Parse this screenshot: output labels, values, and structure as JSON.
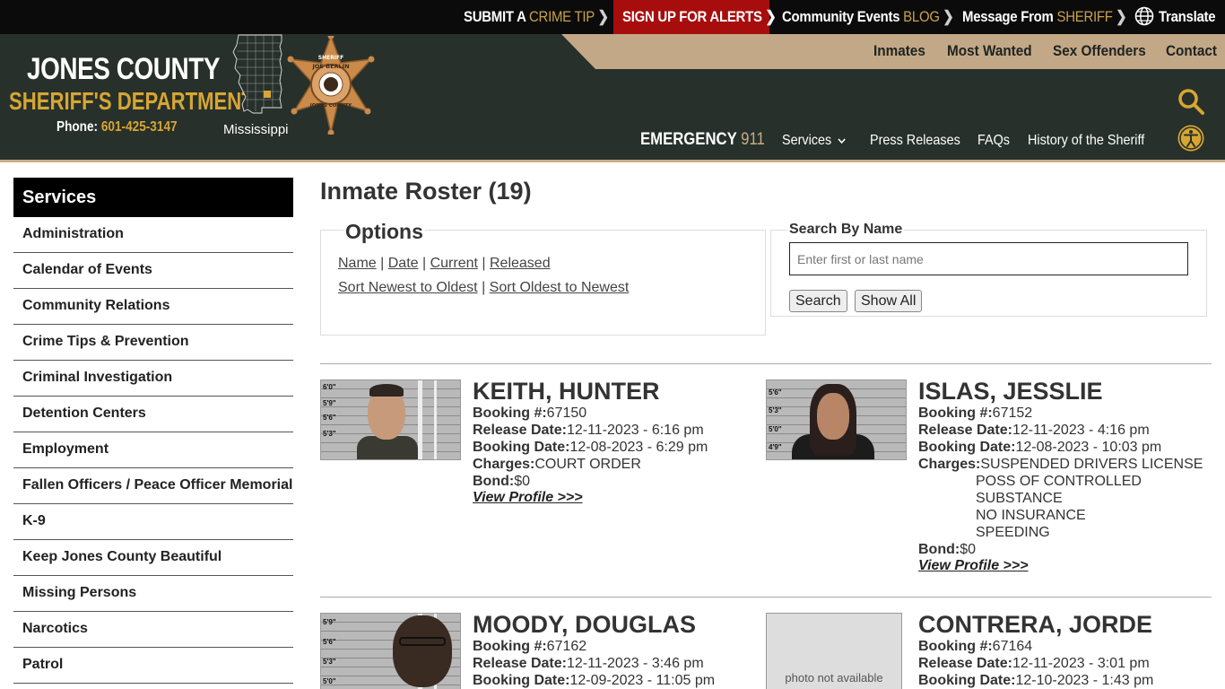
{
  "topbar": {
    "crime_tip": {
      "a": "SUBMIT A ",
      "b": "CRIME TIP",
      "chev": "❯"
    },
    "alerts": {
      "a": "SIGN UP FOR ALERTS",
      "chev": "❯"
    },
    "events": {
      "a": "Community Events ",
      "b": "BLOG",
      "chev": "❯"
    },
    "message": {
      "a": "Message From ",
      "b": "SHERIFF",
      "chev": "❯"
    },
    "translate": "Translate"
  },
  "logo": {
    "title": "JONES COUNTY",
    "subtitle": "SHERIFF'S DEPARTMENT",
    "phone_label": "Phone: ",
    "phone_number": "601-425-3147",
    "state_label": "Mississippi",
    "badge_top": "SHERIFF",
    "badge_name": "JOE BERLIN",
    "badge_bottom": "JONES COUNTY"
  },
  "nav_primary": [
    "Inmates",
    "Most Wanted",
    "Sex Offenders",
    "Contact"
  ],
  "emergency": {
    "label": "EMERGENCY ",
    "number": "911"
  },
  "nav_secondary": {
    "services": "Services",
    "press": "Press Releases",
    "faqs": "FAQs",
    "history": "History of the Sheriff"
  },
  "sidebar": {
    "heading": "Services",
    "items": [
      "Administration",
      "Calendar of Events",
      "Community Relations",
      "Crime Tips & Prevention",
      "Criminal Investigation",
      "Detention Centers",
      "Employment",
      "Fallen Officers / Peace Officer Memorial",
      "K-9",
      "Keep Jones County Beautiful",
      "Missing Persons",
      "Narcotics",
      "Patrol"
    ]
  },
  "main": {
    "title": "Inmate Roster (19)",
    "options": {
      "legend": "Options",
      "sort_name": "Name",
      "sort_date": "Date",
      "sort_current": "Current",
      "sort_released": "Released",
      "sep": " | ",
      "newest": "Sort Newest to Oldest",
      "oldest": "Sort Oldest to Newest"
    },
    "search": {
      "legend": "Search By Name",
      "placeholder": "Enter first or last name",
      "search_btn": "Search",
      "showall_btn": "Show All"
    }
  },
  "labels": {
    "booking": "Booking #:",
    "release": "Release Date:",
    "booking_date": "Booking Date:",
    "charges": "Charges:",
    "bond": "Bond:",
    "view": "View Profile >>>",
    "no_photo": "photo not available"
  },
  "inmates": [
    {
      "name": "KEITH, HUNTER",
      "booking": "67150",
      "release": "12-11-2023 - 6:16 pm",
      "booking_date": "12-08-2023 - 6:29 pm",
      "charges": [
        "COURT ORDER"
      ],
      "bond": "$0"
    },
    {
      "name": "ISLAS, JESSLIE",
      "booking": "67152",
      "release": "12-11-2023 - 4:16 pm",
      "booking_date": "12-08-2023 - 10:03 pm",
      "charges": [
        "SUSPENDED DRIVERS LICENSE",
        "POSS OF CONTROLLED",
        "SUBSTANCE",
        "NO INSURANCE",
        "SPEEDING"
      ],
      "bond": "$0"
    },
    {
      "name": "MOODY, DOUGLAS",
      "booking": "67162",
      "release": "12-11-2023 - 3:46 pm",
      "booking_date": "12-09-2023 - 11:05 pm"
    },
    {
      "name": "CONTRERA, JORDE",
      "booking": "67164",
      "release": "12-11-2023 - 3:01 pm",
      "booking_date": "12-10-2023 - 1:43 pm"
    }
  ],
  "mug_rulers": {
    "keith": [
      "6'0\"",
      "5'9\"",
      "5'6\"",
      "5'3\""
    ],
    "islas": [
      "5'6\"",
      "5'3\"",
      "5'0\"",
      "4'9\""
    ],
    "moody": [
      "5'9\"",
      "5'6\"",
      "5'3\"",
      "5'0\""
    ]
  }
}
